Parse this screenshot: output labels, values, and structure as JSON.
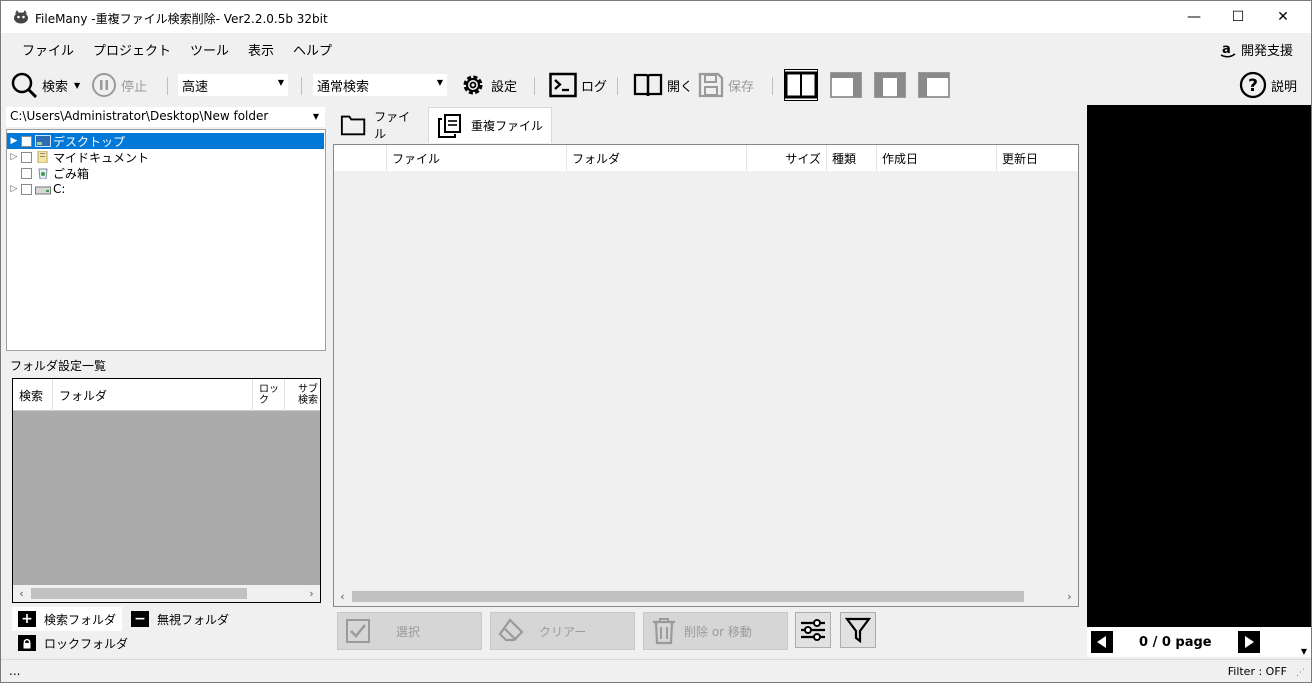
{
  "window": {
    "title": "FileMany -重複ファイル検索削除- Ver2.2.0.5b 32bit",
    "minimize_glyph": "—",
    "maximize_glyph": "☐",
    "close_glyph": "✕"
  },
  "menu": {
    "items": [
      "ファイル",
      "プロジェクト",
      "ツール",
      "表示",
      "ヘルプ"
    ],
    "support_label": "開発支援"
  },
  "toolbar": {
    "search_label": "検索",
    "stop_label": "停止",
    "speed_value": "高速",
    "mode_value": "通常検索",
    "settings_label": "設定",
    "log_label": "ログ",
    "open_label": "開く",
    "save_label": "保存",
    "help_label": "説明"
  },
  "folder_panel": {
    "path": "C:\\Users\\Administrator\\Desktop\\New folder",
    "tree": [
      {
        "label": "デスクトップ",
        "selected": true,
        "expandable": true
      },
      {
        "label": "マイドキュメント",
        "selected": false,
        "expandable": true
      },
      {
        "label": "ごみ箱",
        "selected": false,
        "expandable": false
      },
      {
        "label": "C:",
        "selected": false,
        "expandable": true
      }
    ]
  },
  "folder_settings": {
    "title": "フォルダ設定一覧",
    "columns": [
      "検索",
      "フォルダ",
      "ロック",
      "サブ検索"
    ],
    "tabs": [
      "検索フォルダ",
      "無視フォルダ",
      "ロックフォルダ"
    ]
  },
  "main_tabs": [
    "ファイル",
    "重複ファイル"
  ],
  "results_grid": {
    "columns": [
      "",
      "ファイル",
      "フォルダ",
      "サイズ",
      "種類",
      "作成日",
      "更新日"
    ]
  },
  "actions": {
    "select_label": "選択",
    "clear_label": "クリアー",
    "delete_label": "削除 or 移動"
  },
  "preview": {
    "page_text": "0 / 0 page"
  },
  "status": {
    "left": "...",
    "filter": "Filter : OFF"
  }
}
